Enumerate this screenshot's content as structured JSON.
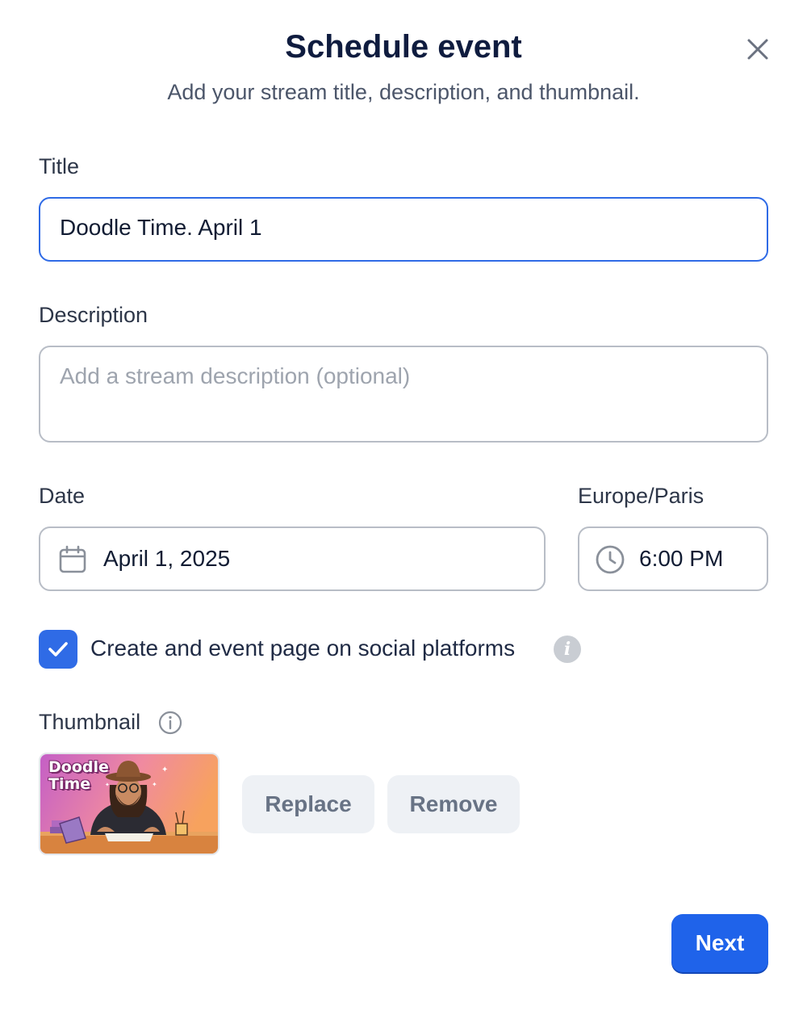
{
  "dialog": {
    "title": "Schedule event",
    "subtitle": "Add your stream title, description, and thumbnail."
  },
  "form": {
    "title_label": "Title",
    "title_value": "Doodle Time. April 1",
    "description_label": "Description",
    "description_placeholder": "Add a stream description (optional)",
    "description_value": "",
    "date_label": "Date",
    "date_value": "April 1, 2025",
    "timezone_label": "Europe/Paris",
    "time_value": "6:00 PM",
    "social_checkbox_label": "Create and event page on social platforms",
    "social_checkbox_checked": true,
    "thumbnail_label": "Thumbnail",
    "thumbnail_text": "Doodle Time"
  },
  "buttons": {
    "replace": "Replace",
    "remove": "Remove",
    "next": "Next"
  },
  "icons": {
    "close": "close-icon",
    "calendar": "calendar-icon",
    "clock": "clock-icon",
    "checkmark": "checkmark-icon",
    "info": "info-icon"
  },
  "colors": {
    "accent": "#1f63ea",
    "focus_border": "#2f6be6",
    "secondary_button_bg": "#eef1f5",
    "secondary_button_text": "#687385"
  }
}
